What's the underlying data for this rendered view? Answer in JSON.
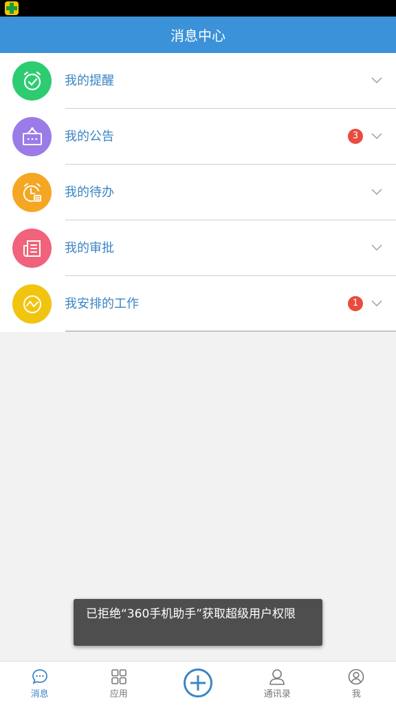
{
  "header": {
    "title": "消息中心"
  },
  "items": [
    {
      "label": "我的提醒",
      "badge": "",
      "color": "#2ecc71",
      "icon": "alarm-check-icon"
    },
    {
      "label": "我的公告",
      "badge": "3",
      "color": "#9b7be8",
      "icon": "notice-board-icon"
    },
    {
      "label": "我的待办",
      "badge": "",
      "color": "#f5a623",
      "icon": "clock-task-icon"
    },
    {
      "label": "我的审批",
      "badge": "",
      "color": "#f0637a",
      "icon": "document-icon"
    },
    {
      "label": "我安排的工作",
      "badge": "1",
      "color": "#f1c40f",
      "icon": "trend-icon"
    }
  ],
  "toast": {
    "text": "已拒绝“360手机助手”获取超级用户权限"
  },
  "tabs": [
    {
      "label": "消息",
      "icon": "chat-icon",
      "active": true
    },
    {
      "label": "应用",
      "icon": "grid-icon",
      "active": false
    },
    {
      "label": "",
      "icon": "add-circle-icon",
      "active": false
    },
    {
      "label": "通讯录",
      "icon": "contacts-icon",
      "active": false
    },
    {
      "label": "我",
      "icon": "profile-icon",
      "active": false
    }
  ],
  "colors": {
    "header": "#3b92d8",
    "accent": "#3a84c4",
    "badge": "#e84c3d"
  }
}
